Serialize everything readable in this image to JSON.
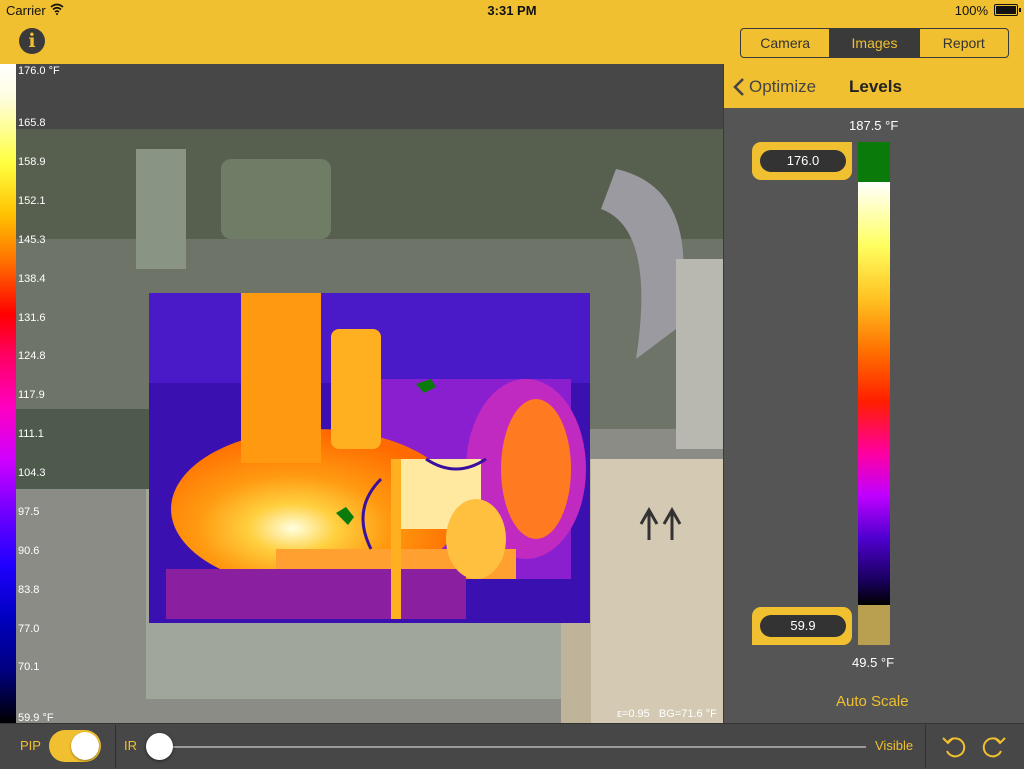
{
  "status": {
    "carrier": "Carrier",
    "time": "3:31 PM",
    "battery": "100%"
  },
  "header": {
    "tabs": [
      {
        "label": "Camera",
        "active": false
      },
      {
        "label": "Images",
        "active": true
      },
      {
        "label": "Report",
        "active": false
      }
    ]
  },
  "scale": {
    "ticks": [
      "176.0 °F",
      "165.8",
      "158.9",
      "152.1",
      "145.3",
      "138.4",
      "131.6",
      "124.8",
      "117.9",
      "111.1",
      "104.3",
      "97.5",
      "90.6",
      "83.8",
      "77.0",
      "70.1",
      "59.9 °F"
    ]
  },
  "image": {
    "emissivity": "ε=0.95",
    "background": "BG=71.6 °F"
  },
  "panel": {
    "back_label": "Optimize",
    "title": "Levels",
    "max_label": "187.5 °F",
    "min_label": "49.5 °F",
    "high_value": "176.0",
    "low_value": "59.9",
    "auto_scale": "Auto Scale"
  },
  "bottom": {
    "pip_label": "PIP",
    "pip_on": true,
    "ir_label": "IR",
    "visible_label": "Visible",
    "blend_fraction": 0.0
  },
  "colors": {
    "accent": "#f0c030",
    "dark": "#3a3a3a"
  }
}
